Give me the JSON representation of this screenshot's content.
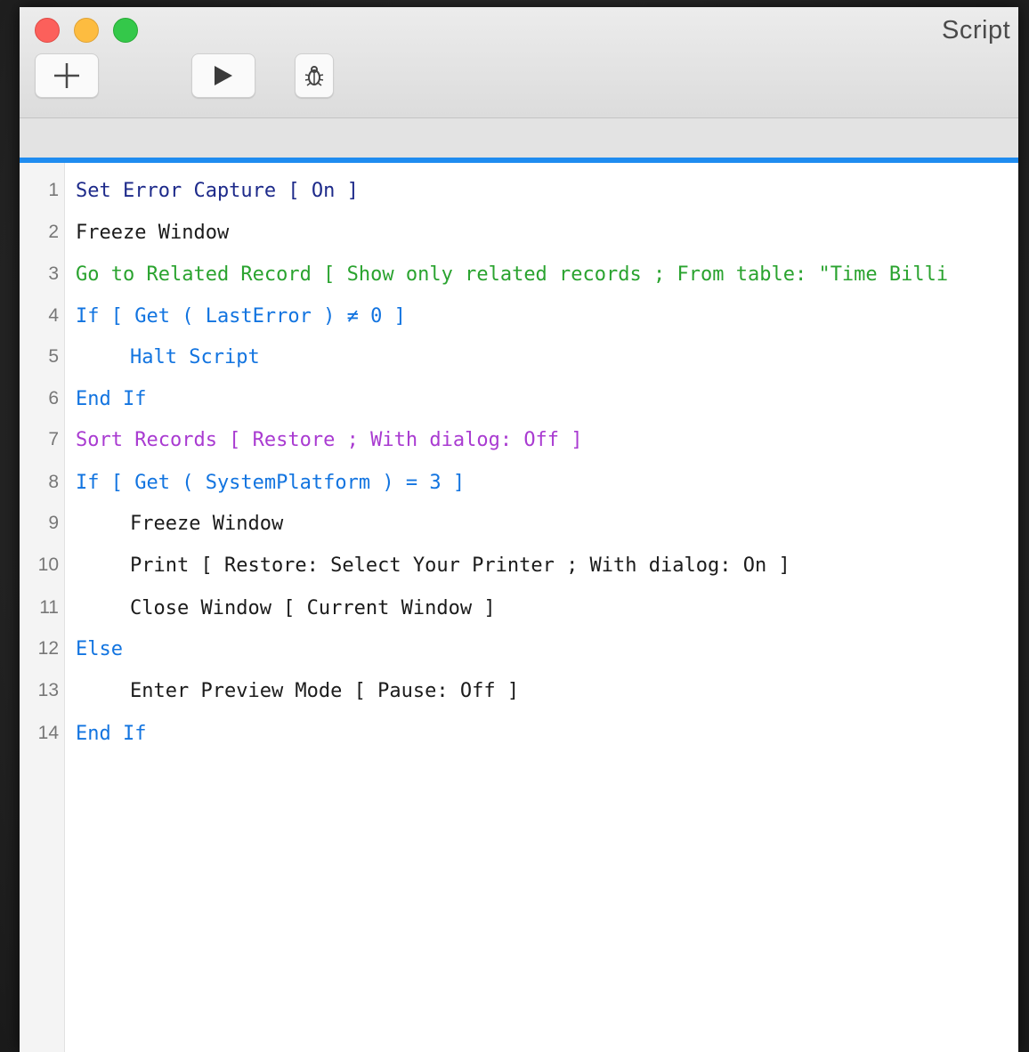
{
  "window": {
    "title": "Script"
  },
  "toolbar": {
    "add_icon": "plus-icon",
    "run_icon": "play-icon",
    "debug_icon": "bug-icon"
  },
  "colors": {
    "accent": "#1f8cf0",
    "control": "#1274e0",
    "step": "#1b1b1b",
    "error_capture": "#1d2a8a",
    "navigation": "#2aa32f",
    "sort": "#a93bd1"
  },
  "script": {
    "lines": [
      {
        "num": "1",
        "text": "Set Error Capture [ On ]",
        "indent": 0
      },
      {
        "num": "2",
        "text": "Freeze Window",
        "indent": 0
      },
      {
        "num": "3",
        "text": "Go to Related Record [ Show only related records ; From table: \"Time Billi",
        "indent": 0
      },
      {
        "num": "4",
        "text": "If [ Get ( LastError ) ≠ 0 ]",
        "indent": 0
      },
      {
        "num": "5",
        "text": "Halt Script",
        "indent": 1
      },
      {
        "num": "6",
        "text": "End If",
        "indent": 0
      },
      {
        "num": "7",
        "text": "Sort Records [ Restore ; With dialog: Off ]",
        "indent": 0
      },
      {
        "num": "8",
        "text": "If [ Get ( SystemPlatform ) = 3 ]",
        "indent": 0
      },
      {
        "num": "9",
        "text": "Freeze Window",
        "indent": 1
      },
      {
        "num": "10",
        "text": "Print [ Restore: Select Your Printer ; With dialog: On ]",
        "indent": 1
      },
      {
        "num": "11",
        "text": "Close Window [ Current Window ]",
        "indent": 1
      },
      {
        "num": "12",
        "text": "Else",
        "indent": 0
      },
      {
        "num": "13",
        "text": "Enter Preview Mode [ Pause: Off ]",
        "indent": 1
      },
      {
        "num": "14",
        "text": "End If",
        "indent": 0
      }
    ]
  }
}
